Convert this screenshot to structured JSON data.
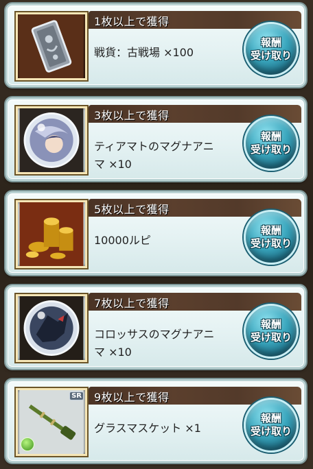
{
  "claim_button": {
    "line1": "報酬",
    "line2": "受け取り"
  },
  "rewards": [
    {
      "requirement": "1枚以上で獲得",
      "name_line1": "戦貨：古戦場 ×100",
      "name_line2": "",
      "icon": "silver-card-icon"
    },
    {
      "requirement": "3枚以上で獲得",
      "name_line1": "ティアマトのマグナアニ",
      "name_line2": "マ ×10",
      "icon": "tiamat-orb-icon"
    },
    {
      "requirement": "5枚以上で獲得",
      "name_line1": "10000ルピ",
      "name_line2": "",
      "icon": "gold-coins-icon"
    },
    {
      "requirement": "7枚以上で獲得",
      "name_line1": "コロッサスのマグナアニ",
      "name_line2": "マ ×10",
      "icon": "colossus-orb-icon"
    },
    {
      "requirement": "9枚以上で獲得",
      "name_line1": "グラスマスケット ×1",
      "name_line2": "",
      "icon": "musket-icon",
      "badge": "SR"
    }
  ]
}
